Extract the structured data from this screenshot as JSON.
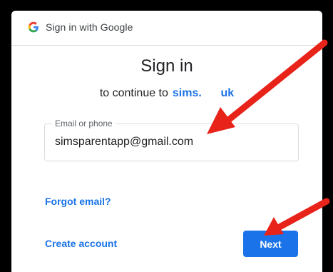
{
  "titlebar": {
    "title": "Sign in with Google",
    "logo_icon": "google-g-icon"
  },
  "main": {
    "heading": "Sign in",
    "subheading_prefix": "to continue to",
    "subheading_link": "sims.co.uk",
    "subheading_link_visible": "sims.",
    "subheading_link_visible_tail": "uk"
  },
  "email_field": {
    "label": "Email or phone",
    "value": "simsparentapp@gmail.com"
  },
  "links": {
    "forgot_email": "Forgot email?",
    "create_account": "Create account"
  },
  "buttons": {
    "next": "Next"
  },
  "colors": {
    "accent": "#1a73e8",
    "annotation_arrow": "#e8231a",
    "background": "#000000"
  },
  "annotations": {
    "arrow_icon": "red-arrow-icon"
  }
}
